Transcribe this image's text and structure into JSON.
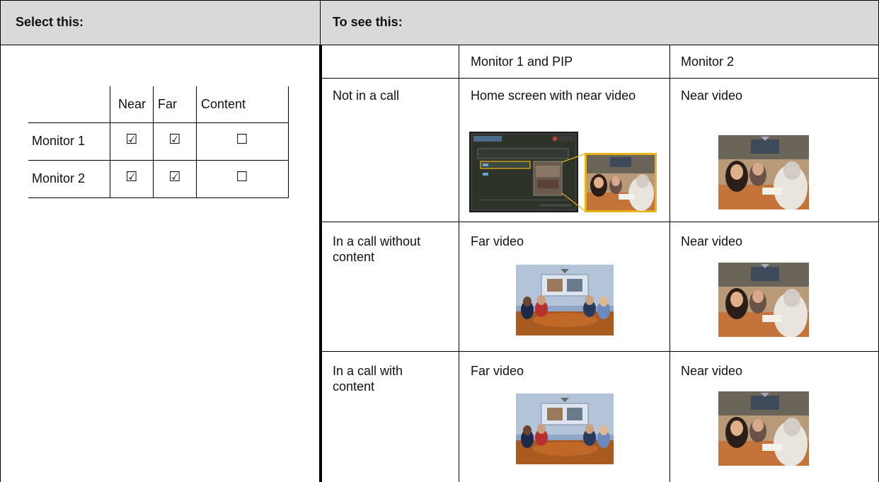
{
  "header": {
    "select_label": "Select this:",
    "see_label": "To see this:"
  },
  "selection_grid": {
    "columns": [
      "Near",
      "Far",
      "Content"
    ],
    "rows": [
      {
        "label": "Monitor 1",
        "near": "☑",
        "far": "☑",
        "content": "☐"
      },
      {
        "label": "Monitor 2",
        "near": "☑",
        "far": "☑",
        "content": "☐"
      }
    ]
  },
  "results": {
    "columns": [
      "Monitor 1 and PIP",
      "Monitor 2"
    ],
    "rows": [
      {
        "state": "Not in a call",
        "monitor1": "Home screen with near video",
        "monitor2": "Near video"
      },
      {
        "state": "In a call without content",
        "monitor1": "Far video",
        "monitor2": "Near video"
      },
      {
        "state": "In a call with content",
        "monitor1": "Far video",
        "monitor2": "Near video"
      }
    ]
  }
}
